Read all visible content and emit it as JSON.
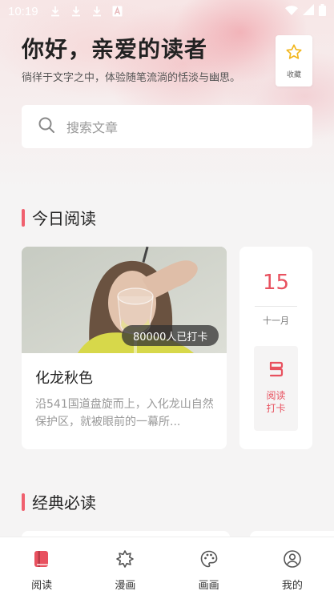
{
  "status_bar": {
    "time": "10:19",
    "icons": [
      "download-icon",
      "download-icon",
      "download-icon",
      "a-icon",
      "wifi-icon",
      "signal-icon",
      "battery-icon"
    ]
  },
  "header": {
    "greeting": "你好，亲爱的读者",
    "subtitle": "徜徉于文字之中，体验随笔流淌的恬淡与幽思。",
    "favorite_label": "收藏"
  },
  "search": {
    "placeholder": "搜索文章"
  },
  "today": {
    "section_title": "今日阅读",
    "card": {
      "image": "woman-with-wine-glass",
      "badge": "80000人已打卡",
      "title": "化龙秋色",
      "description": "沿541国道盘旋而上，入化龙山自然保护区，就被眼前的一幕所..."
    },
    "date": {
      "day": "15",
      "month": "十一月",
      "checkin_label": "阅读打卡"
    }
  },
  "classics": {
    "section_title": "经典必读"
  },
  "tabbar": {
    "items": [
      {
        "label": "阅读",
        "icon": "book-icon",
        "active": true
      },
      {
        "label": "漫画",
        "icon": "comic-icon",
        "active": false
      },
      {
        "label": "画画",
        "icon": "palette-icon",
        "active": false
      },
      {
        "label": "我的",
        "icon": "profile-icon",
        "active": false
      }
    ]
  },
  "colors": {
    "accent": "#e8515f",
    "background": "#f5f4f4"
  }
}
